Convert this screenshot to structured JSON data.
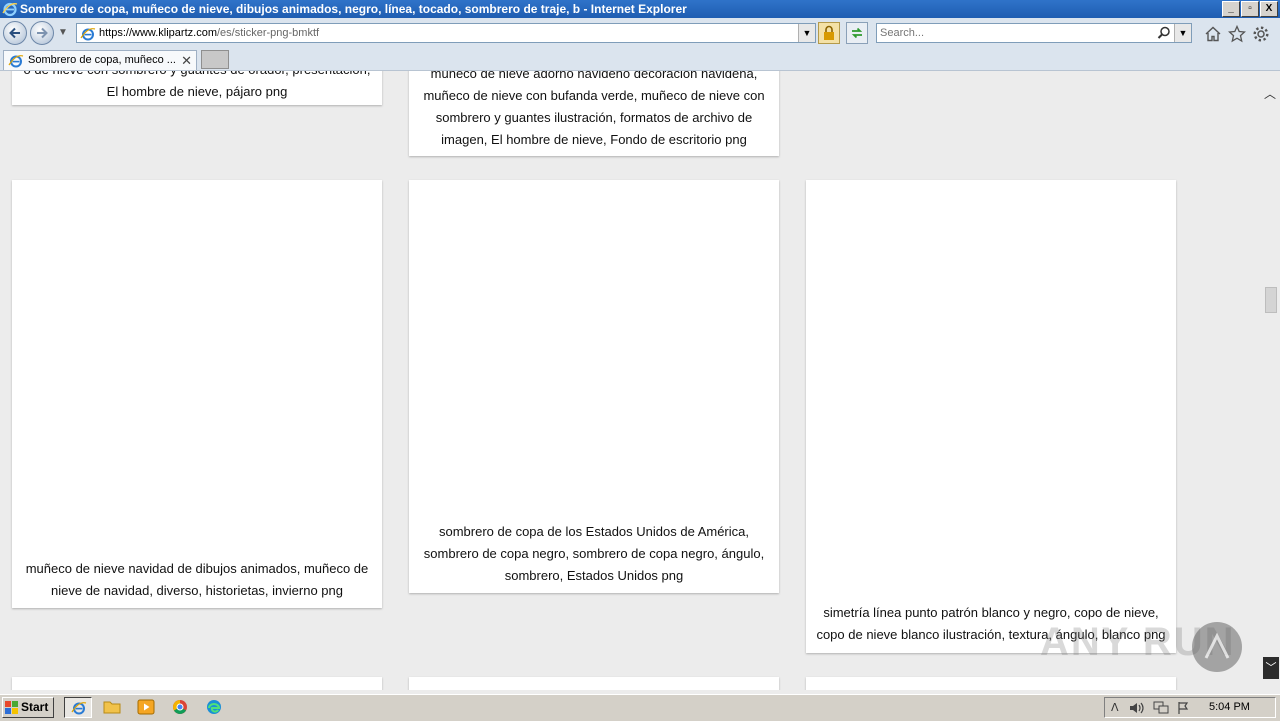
{
  "window": {
    "title": "Sombrero de copa, muñeco de nieve, dibujos animados, negro, línea, tocado, sombrero de traje, b - Internet Explorer",
    "minimize_glyph": "_",
    "maximize_glyph": "▫",
    "close_glyph": "X"
  },
  "address_bar": {
    "url_host": "https://www.klipartz.com",
    "url_rest": "/es/sticker-png-bmktf",
    "dropdown_glyph": "▼"
  },
  "search": {
    "placeholder": "Search...",
    "dropdown_glyph": "▼"
  },
  "tabs": [
    {
      "label": "Sombrero de copa, muñeco ...",
      "close_glyph": "✕"
    }
  ],
  "content": {
    "cards": [
      {
        "caption": "o de nieve con sombrero y guantes de orador, presentación, El hombre de nieve, pájaro png"
      },
      {
        "caption": "muñeco de nieve adorno navideño decoración navideña, muñeco de nieve con bufanda verde, muñeco de nieve con sombrero y guantes ilustración, formatos de archivo de imagen, El hombre de nieve, Fondo de escritorio png"
      },
      {
        "caption": "muñeco de nieve navidad de dibujos animados, muñeco de nieve de navidad, diverso, historietas, invierno png"
      },
      {
        "caption": "sombrero de copa de los Estados Unidos de América, sombrero de copa negro, sombrero de copa negro, ángulo, sombrero, Estados Unidos png"
      },
      {
        "caption": "simetría línea punto patrón blanco y negro, copo de nieve, copo de nieve blanco ilustración, textura, ángulo, blanco png"
      }
    ]
  },
  "scrollbar": {
    "up_glyph": "︿",
    "down_glyph": "﹀"
  },
  "watermark": {
    "text": "ANY RUN"
  },
  "taskbar": {
    "start_label": "Start",
    "clock": "5:04 PM",
    "tray_expand_glyph": "ᐱ"
  }
}
